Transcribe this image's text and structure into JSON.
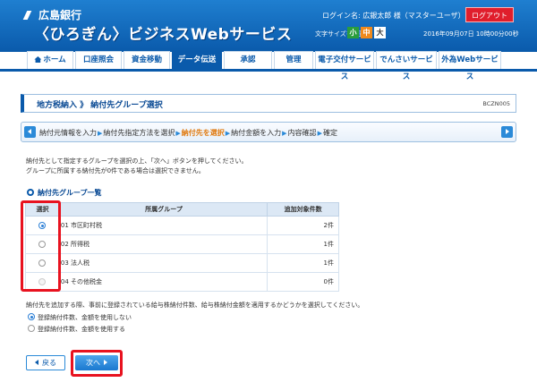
{
  "header": {
    "bank_name": "広島銀行",
    "service_name": "〈ひろぎん〉ビジネスWebサービス",
    "login_label": "ログイン名:",
    "user_name": "広銀太郎 様（マスターユーザ）",
    "logout_label": "ログアウト",
    "font_size_label": "文字サイズを変更",
    "font_sizes": [
      "小",
      "中",
      "大"
    ],
    "datetime": "2016年09月07日 10時00分00秒",
    "brand_color": "#0a5aab"
  },
  "nav": {
    "tabs": [
      "ホーム",
      "口座照会",
      "資金移動",
      "データ伝送",
      "承認",
      "管理",
      "電子交付サービス",
      "でんさいサービス",
      "外為Webサービス"
    ],
    "active": "データ伝送"
  },
  "page": {
    "title": "地方税納入 》 納付先グループ選択",
    "screen_id": "BCZN005"
  },
  "steps": {
    "items": [
      "納付元情報を入力",
      "納付先指定方法を選択",
      "納付先を選択",
      "納付金額を入力",
      "内容確認",
      "確定"
    ],
    "current_index": 2
  },
  "instructions": {
    "line1": "納付先として指定するグループを選択の上、「次へ」ボタンを押してください。",
    "line2": "グループに所属する納付先が0件である場合は選択できません。"
  },
  "group_section": {
    "heading": "納付先グループ一覧",
    "columns": [
      "選択",
      "所属グループ",
      "追加対象件数"
    ],
    "rows": [
      {
        "group": "01 市区町村税",
        "count": "2件",
        "selected": true,
        "disabled": false
      },
      {
        "group": "02 所得税",
        "count": "1件",
        "selected": false,
        "disabled": false
      },
      {
        "group": "03 法人税",
        "count": "1件",
        "selected": false,
        "disabled": false
      },
      {
        "group": "04 その他税金",
        "count": "0件",
        "selected": false,
        "disabled": true
      }
    ]
  },
  "options": {
    "note": "納付先を追加する際、事前に登録されている給与株納付件数、給与株納付金額を適用するかどうかを選択してください。",
    "choices": [
      "登録納付件数、金額を使用しない",
      "登録納付件数、金額を使用する"
    ],
    "selected_index": 0
  },
  "buttons": {
    "back": "戻る",
    "next": "次へ"
  },
  "highlight_color": "#e8121f"
}
